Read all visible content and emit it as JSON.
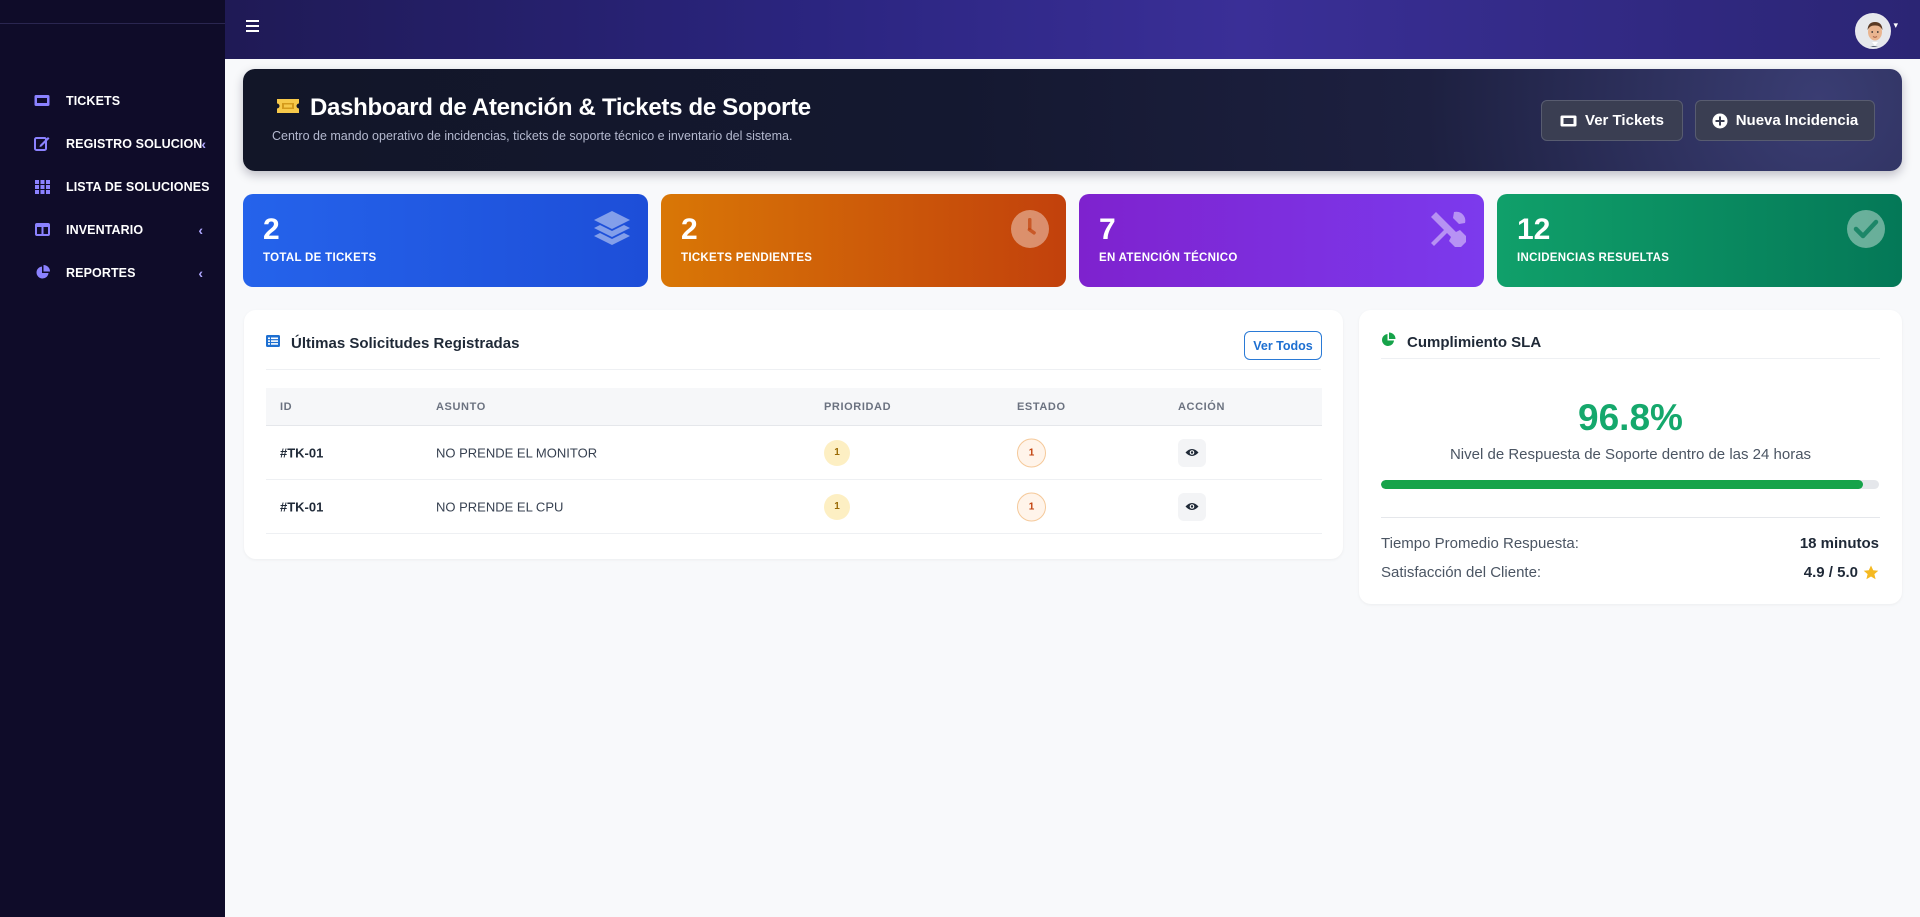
{
  "colors": {
    "sidebar_bg": "#0f0c29",
    "topbar_gradient": "#2b2580",
    "card_blue": "#2563eb",
    "card_orange": "#d97706",
    "card_purple": "#7c3aed",
    "card_green": "#059669",
    "sla_green": "#15a86c"
  },
  "sidebar": {
    "items": [
      {
        "label": "TICKETS",
        "icon": "ticket-icon",
        "has_chevron": false
      },
      {
        "label": "REGISTRO SOLUCION",
        "icon": "edit-icon",
        "has_chevron": true
      },
      {
        "label": "LISTA DE SOLUCIONES",
        "icon": "grid-icon",
        "has_chevron": false
      },
      {
        "label": "INVENTARIO",
        "icon": "columns-icon",
        "has_chevron": true
      },
      {
        "label": "REPORTES",
        "icon": "pie-chart-icon",
        "has_chevron": true
      }
    ]
  },
  "topbar": {
    "menu_icon": "hamburger-icon",
    "avatar_icon": "user-avatar",
    "avatar_caret": "▾"
  },
  "hero": {
    "title": "Dashboard de Atención & Tickets de Soporte",
    "subtitle": "Centro de mando operativo de incidencias, tickets de soporte técnico e inventario del sistema.",
    "btn_ver": "Ver Tickets",
    "btn_nueva": "Nueva Incidencia"
  },
  "stats": [
    {
      "value": "2",
      "label": "TOTAL DE TICKETS",
      "icon": "layers-icon"
    },
    {
      "value": "2",
      "label": "TICKETS PENDIENTES",
      "icon": "clock-icon"
    },
    {
      "value": "7",
      "label": "EN ATENCIÓN TÉCNICO",
      "icon": "tools-icon"
    },
    {
      "value": "12",
      "label": "INCIDENCIAS RESUELTAS",
      "icon": "check-circle-icon"
    }
  ],
  "requests": {
    "title": "Últimas Solicitudes Registradas",
    "view_all": "Ver Todos",
    "columns": [
      "ID",
      "ASUNTO",
      "PRIORIDAD",
      "ESTADO",
      "ACCIÓN"
    ],
    "rows": [
      {
        "id": "#TK-01",
        "asunto": "NO PRENDE EL MONITOR",
        "prioridad": "1",
        "estado": "1",
        "accion_icon": "eye-icon"
      },
      {
        "id": "#TK-01",
        "asunto": "NO PRENDE EL CPU",
        "prioridad": "1",
        "estado": "1",
        "accion_icon": "eye-icon"
      }
    ]
  },
  "sla": {
    "title": "Cumplimiento SLA",
    "percent": "96.8%",
    "percent_value": 0.968,
    "description": "Nivel de Respuesta de Soporte dentro de las 24 horas",
    "avg_label": "Tiempo Promedio Respuesta:",
    "avg_value": "18 minutos",
    "sat_label": "Satisfacción del Cliente:",
    "sat_value": "4.9 / 5.0",
    "sat_icon": "star-icon"
  }
}
